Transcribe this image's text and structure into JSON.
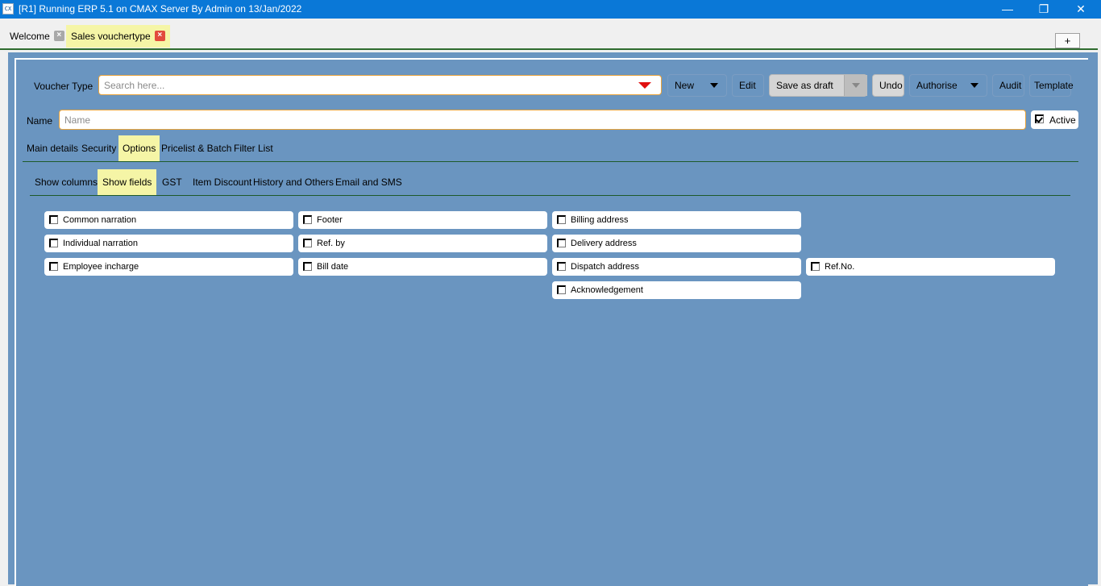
{
  "window": {
    "title": "[R1] Running ERP 5.1 on CMAX Server By Admin on 13/Jan/2022",
    "icon": "cmax-app-icon",
    "icon_text": "CX",
    "controls": {
      "minimize": "—",
      "maximize": "❐",
      "close": "✕"
    }
  },
  "doc_tabs": {
    "items": [
      {
        "label": "Welcome",
        "close": "×"
      },
      {
        "label": "Sales vouchertype",
        "close": "×"
      }
    ],
    "add_label": "+"
  },
  "toolbar": {
    "voucher_type_label": "Voucher Type",
    "search_placeholder": "Search here...",
    "new_label": "New",
    "edit_label": "Edit",
    "save_as_draft_label": "Save as draft",
    "undo_label": "Undo",
    "authorise_label": "Authorise",
    "audit_label": "Audit",
    "template_label": "Template"
  },
  "name_row": {
    "name_label": "Name",
    "name_placeholder": "Name",
    "active_label": "Active",
    "active_checked": true
  },
  "main_tabs": [
    "Main details",
    "Security",
    "Options",
    "Pricelist & Batch",
    "Filter List"
  ],
  "main_tabs_selected": "Options",
  "sub_tabs": [
    "Show columns",
    "Show fields",
    "GST",
    "Item Discount",
    "History and Others",
    "Email and SMS"
  ],
  "sub_tabs_selected": "Show fields",
  "fields": {
    "col1": [
      "Common narration",
      "Individual narration",
      "Employee incharge"
    ],
    "col2": [
      "Footer",
      "Ref. by",
      "Bill date"
    ],
    "col3": [
      "Billing address",
      "Delivery address",
      "Dispatch address",
      "Acknowledgement"
    ],
    "col4": [
      "Ref.No."
    ]
  },
  "colors": {
    "titlebar": "#0a78d7",
    "panel": "#6a95c0",
    "selected_tab": "#f5f5a6",
    "input_border": "#e8a33c",
    "separator": "#1e5a2a"
  }
}
